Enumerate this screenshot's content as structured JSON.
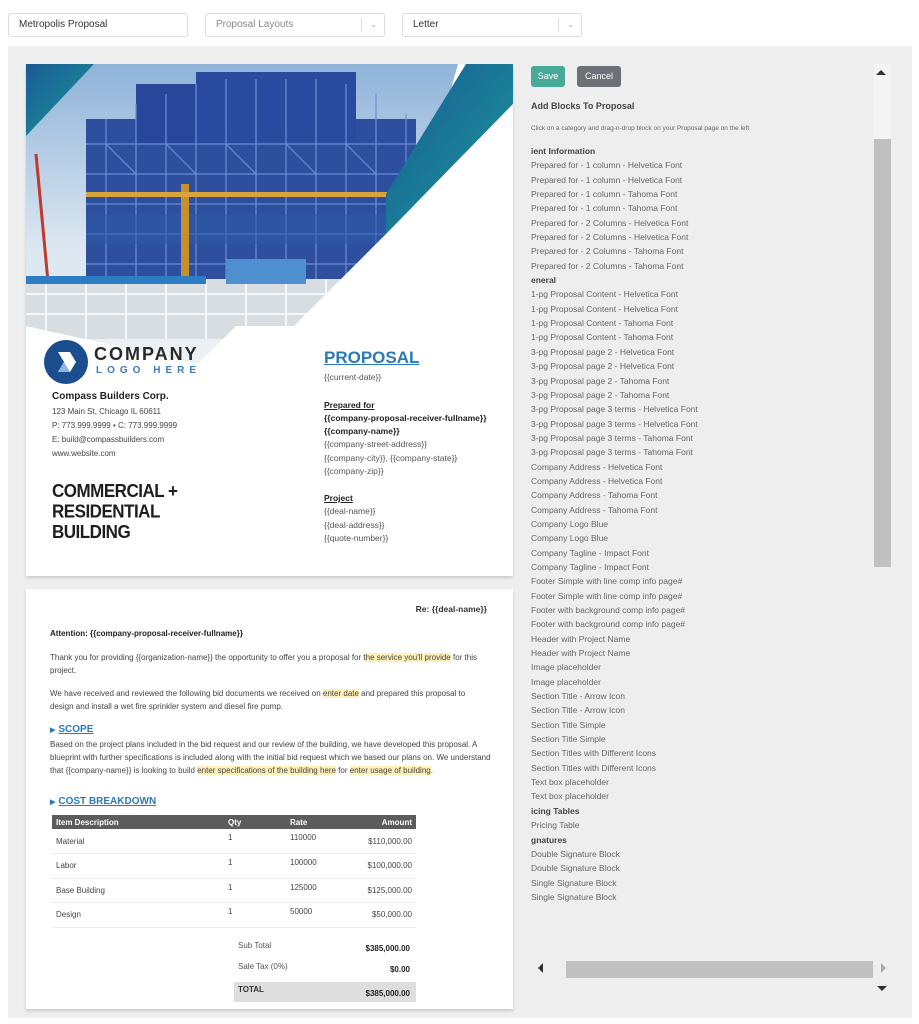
{
  "topbar": {
    "proposal_name": "Metropolis Proposal",
    "layout_select": {
      "placeholder": "Proposal Layouts"
    },
    "paper_select": {
      "value": "Letter"
    }
  },
  "cover": {
    "logo_line1": "COMPANY",
    "logo_line2": "LOGO HERE",
    "company_name": "Compass Builders Corp.",
    "address": "123 Main St, Chicago IL 60611",
    "phones": "P: 773.999.9999   •   C: 773.999.9999",
    "email": "E: build@compassbuilders.com",
    "website": "www.website.com",
    "headline": [
      "COMMERCIAL +",
      "RESIDENTIAL",
      "BUILDING"
    ],
    "proposal_title": "PROPOSAL",
    "current_date": "{{current-date}}",
    "prepared_for_label": "Prepared for",
    "receiver_fullname": "{{company-proposal-receiver-fullname}}",
    "company_name_var": "{{company-name}}",
    "street": "{{company-street-address}}",
    "city_state": "{{company-city}}, {{company-state}}",
    "zip": "{{company-zip}}",
    "project_label": "Project",
    "deal_name": "{{deal-name}}",
    "deal_address": "{{deal-address}}",
    "quote_number": "{{quote-number}}"
  },
  "page2": {
    "re_line": "Re: {{deal-name}}",
    "attention": "Attention: {{company-proposal-receiver-fullname}}",
    "para1_a": "Thank you for providing {{organization-name}} the opportunity to offer you a proposal for ",
    "para1_hl": "the service you'll provide",
    "para1_b": " for this project.",
    "para2_a": "We have received and reviewed the following bid documents we received on ",
    "para2_hl": "enter date",
    "para2_b": " and prepared this proposal to design and install a wet fire sprinkler system and diesel fire pump.",
    "scope_title": "SCOPE",
    "scope_a": "Based on the project plans included in the bid request and our review of the building, we have developed this proposal. A blueprint with further specifications is included along with the initial bid request which we based our plans on. We understand that {{company-name}} is looking to build ",
    "scope_hl1": "enter specifications of the building here",
    "scope_b": " for ",
    "scope_hl2": "enter usage of building",
    "scope_c": ".",
    "cost_title": "COST BREAKDOWN",
    "table": {
      "headers": [
        "Item Description",
        "Qty",
        "Rate",
        "Amount"
      ],
      "rows": [
        [
          "Material",
          "1",
          "110000",
          "$110,000.00"
        ],
        [
          "Labor",
          "1",
          "100000",
          "$100,000.00"
        ],
        [
          "Base Building",
          "1",
          "125000",
          "$125,000.00"
        ],
        [
          "Design",
          "1",
          "50000",
          "$50,000.00"
        ]
      ]
    },
    "subtotal_label": "Sub Total",
    "subtotal_value": "$385,000.00",
    "tax_label": "Sale Tax (0%)",
    "tax_value": "$0.00",
    "total_label": "TOTAL",
    "total_value": "$385,000.00"
  },
  "panel": {
    "save_label": "Save",
    "cancel_label": "Cancel",
    "title": "Add Blocks To Proposal",
    "hint": "Click on a category and drag-n-drop block on your Proposal page on the left",
    "items": [
      {
        "label": "ient Information",
        "category": true
      },
      {
        "label": "Prepared for - 1 column - Helvetica Font"
      },
      {
        "label": "Prepared for - 1 column - Helvetica Font"
      },
      {
        "label": "Prepared for - 1 column - Tahoma Font"
      },
      {
        "label": "Prepared for - 1 column - Tahoma Font"
      },
      {
        "label": "Prepared for - 2 Columns - Helvetica Font"
      },
      {
        "label": "Prepared for - 2 Columns - Helvetica Font"
      },
      {
        "label": "Prepared for - 2 Columns - Tahoma Font"
      },
      {
        "label": "Prepared for - 2 Columns - Tahoma Font"
      },
      {
        "label": "eneral",
        "category": true
      },
      {
        "label": "1-pg Proposal Content - Helvetica Font"
      },
      {
        "label": "1-pg Proposal Content - Helvetica Font"
      },
      {
        "label": "1-pg Proposal Content - Tahoma Font"
      },
      {
        "label": "1-pg Proposal Content - Tahoma Font"
      },
      {
        "label": "3-pg Proposal page 2 - Helvetica Font"
      },
      {
        "label": "3-pg Proposal page 2 - Helvetica Font"
      },
      {
        "label": "3-pg Proposal page 2 - Tahoma Font"
      },
      {
        "label": "3-pg Proposal page 2 - Tahoma Font"
      },
      {
        "label": "3-pg Proposal page 3 terms - Helvetica Font"
      },
      {
        "label": "3-pg Proposal page 3 terms - Helvetica Font"
      },
      {
        "label": "3-pg Proposal page 3 terms - Tahoma Font"
      },
      {
        "label": "3-pg Proposal page 3 terms - Tahoma Font"
      },
      {
        "label": "Company Address - Helvetica Font"
      },
      {
        "label": "Company Address - Helvetica Font"
      },
      {
        "label": "Company Address - Tahoma Font"
      },
      {
        "label": "Company Address - Tahoma Font"
      },
      {
        "label": "Company Logo Blue"
      },
      {
        "label": "Company Logo Blue"
      },
      {
        "label": "Company Tagline - Impact Font"
      },
      {
        "label": "Company Tagline - Impact Font"
      },
      {
        "label": "Footer Simple with line comp info page#"
      },
      {
        "label": "Footer Simple with line comp info page#"
      },
      {
        "label": "Footer with background comp info page#"
      },
      {
        "label": "Footer with background comp info page#"
      },
      {
        "label": "Header with Project Name"
      },
      {
        "label": "Header with Project Name"
      },
      {
        "label": "Image placeholder"
      },
      {
        "label": "Image placeholder"
      },
      {
        "label": "Section Title - Arrow Icon"
      },
      {
        "label": "Section Title - Arrow Icon"
      },
      {
        "label": "Section Title Simple"
      },
      {
        "label": "Section Title Simple"
      },
      {
        "label": "Section Titles with Different Icons"
      },
      {
        "label": "Section Titles with Different Icons"
      },
      {
        "label": "Text box placeholder"
      },
      {
        "label": "Text box placeholder"
      },
      {
        "label": "icing Tables",
        "category": true
      },
      {
        "label": "Pricing Table"
      },
      {
        "label": "gnatures",
        "category": true
      },
      {
        "label": "Double Signature Block"
      },
      {
        "label": "Double Signature Block"
      },
      {
        "label": "Single Signature Block"
      },
      {
        "label": "Single Signature Block"
      }
    ]
  },
  "colors": {
    "save": "#48a999",
    "cancel": "#6c7077",
    "accent_blue": "#2a7ab8",
    "logo_blue": "#1a4e8f",
    "highlight": "#fdf0b8"
  }
}
